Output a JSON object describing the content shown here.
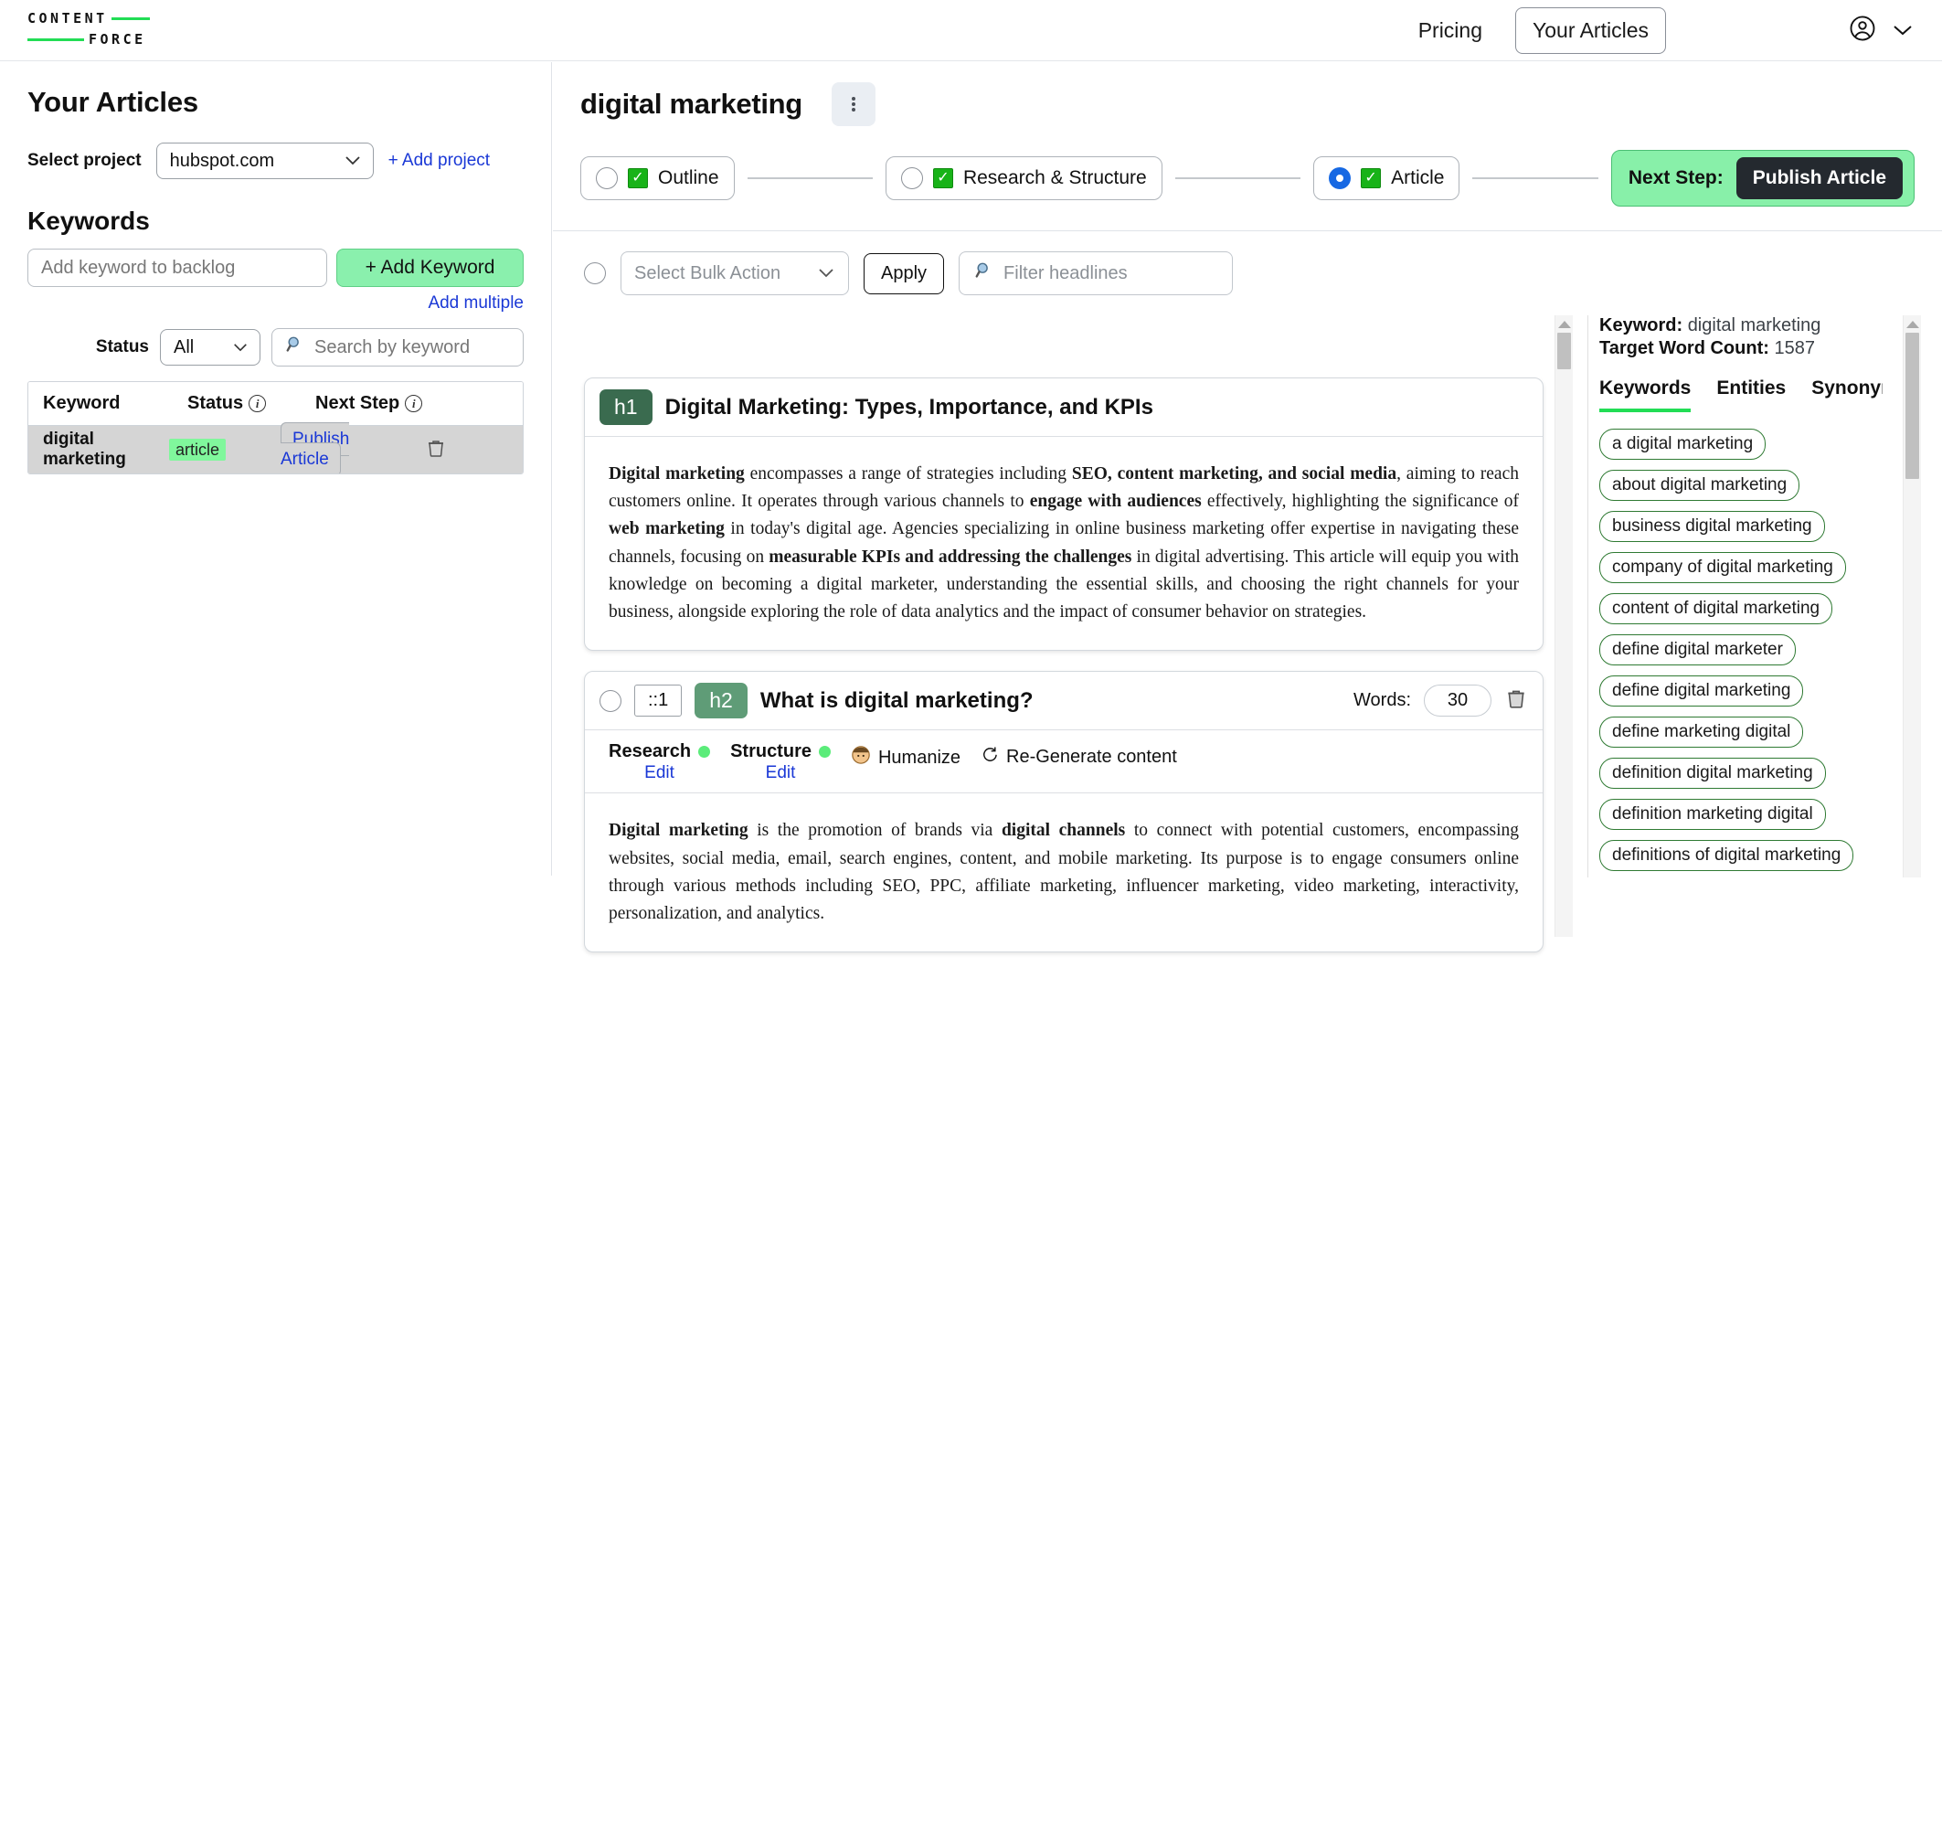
{
  "topnav": {
    "logo_line1": "CONTENT",
    "logo_line2": "FORCE",
    "pricing": "Pricing",
    "your_articles": "Your Articles",
    "accent": "#22dd55"
  },
  "sidebar": {
    "title": "Your Articles",
    "select_project_label": "Select project",
    "project_value": "hubspot.com",
    "add_project": "+ Add project",
    "keywords_title": "Keywords",
    "add_keyword_placeholder": "Add keyword to backlog",
    "add_keyword_button": "+ Add Keyword",
    "add_multiple": "Add multiple",
    "status_label": "Status",
    "status_value": "All",
    "search_placeholder": "Search by keyword",
    "table": {
      "headers": [
        "Keyword",
        "Status",
        "Next Step"
      ],
      "rows": [
        {
          "keyword": "digital marketing",
          "status": "article",
          "next_step": "Publish Article"
        }
      ]
    }
  },
  "main": {
    "doc_title": "digital marketing",
    "steps": [
      {
        "label": "Outline",
        "selected": false,
        "checked": true
      },
      {
        "label": "Research & Structure",
        "selected": false,
        "checked": true
      },
      {
        "label": "Article",
        "selected": true,
        "checked": true
      }
    ],
    "next_step_label": "Next Step:",
    "publish_button": "Publish Article",
    "toolbar": {
      "bulk_action_placeholder": "Select Bulk Action",
      "apply_label": "Apply",
      "filter_placeholder": "Filter headlines"
    },
    "cards": [
      {
        "tag": "h1",
        "title": "Digital Marketing: Types, Importance, and KPIs",
        "body_html": "<b>Digital marketing</b> encompasses a range of strategies including <b>SEO, content marketing, and social media</b>, aiming to reach customers online. It operates through various channels to <b>engage with audiences</b> effectively, highlighting the significance of <b>web marketing</b> in today's digital age. Agencies specializing in online business marketing offer expertise in navigating these channels, focusing on <b>measurable KPIs and addressing the challenges</b> in digital advertising. This article will equip you with knowledge on becoming a digital marketer, understanding the essential skills, and choosing the right channels for your business, alongside exploring the role of data analytics and the impact of consumer behavior on strategies."
      },
      {
        "tag": "h2",
        "index": "::1",
        "title": "What is digital marketing?",
        "words_label": "Words:",
        "words_value": "30",
        "research_label": "Research",
        "structure_label": "Structure",
        "edit_label": "Edit",
        "humanize_label": "Humanize",
        "regenerate_label": "Re-Generate content",
        "body_html": "<b>Digital marketing</b> is the promotion of brands via <b>digital channels</b> to connect with potential customers, encompassing websites, social media, email, search engines, content, and mobile marketing. Its purpose is to engage consumers online through various methods including SEO, PPC, affiliate marketing, influencer marketing, video marketing, interactivity, personalization, and analytics."
      }
    ]
  },
  "right_panel": {
    "keyword_label": "Keyword:",
    "keyword_value": "digital marketing",
    "target_label": "Target Word Count:",
    "target_value": "1587",
    "tabs": [
      "Keywords",
      "Entities",
      "Synonyms"
    ],
    "active_tab": "Keywords",
    "pills": [
      "a digital marketing",
      "about digital marketing",
      "business digital marketing",
      "company of digital marketing",
      "content of digital marketing",
      "define digital marketer",
      "define digital marketing",
      "define marketing digital",
      "definition digital marketing",
      "definition marketing digital",
      "definitions of digital marketing"
    ]
  }
}
